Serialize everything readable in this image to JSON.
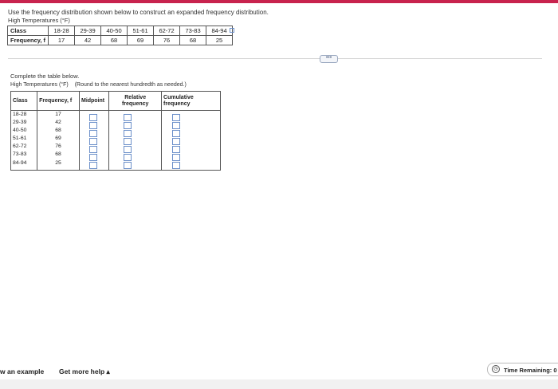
{
  "question": {
    "text": "Use the frequency distribution shown below to construct an expanded frequency distribution.",
    "table_title": "High Temperatures (°F)"
  },
  "freq_table": {
    "row_labels": [
      "Class",
      "Frequency, f"
    ],
    "classes": [
      "18-28",
      "29-39",
      "40-50",
      "51-61",
      "62-72",
      "73-83",
      "84-94"
    ],
    "frequencies": [
      "17",
      "42",
      "68",
      "69",
      "76",
      "68",
      "25"
    ]
  },
  "more_button": "•••",
  "answer": {
    "instruction": "Complete the table below.",
    "table_title": "High Temperatures (°F)",
    "rounding_note": "(Round to the nearest hundredth as needed.)",
    "headers": {
      "class": "Class",
      "frequency": "Frequency, f",
      "midpoint": "Midpoint",
      "relative": "Relative frequency",
      "cumulative": "Cumulative frequency"
    },
    "classes": [
      "18-28",
      "29-39",
      "40-50",
      "51-61",
      "62-72",
      "73-83",
      "84-94"
    ],
    "frequencies": [
      "17",
      "42",
      "68",
      "69",
      "76",
      "68",
      "25"
    ]
  },
  "footer": {
    "view_example": "w an example",
    "get_help": "Get more help ▴",
    "time_remaining": "Time Remaining: 0"
  }
}
